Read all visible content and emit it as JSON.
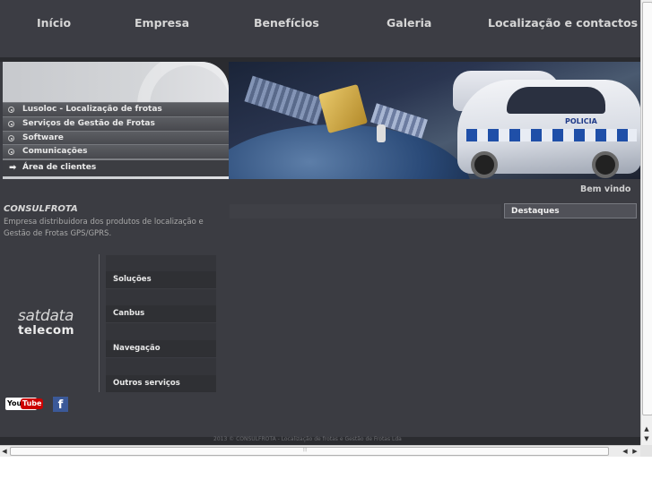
{
  "nav": {
    "items": [
      "Início",
      "Empresa",
      "Benefícios",
      "Galeria",
      "Localização e contactos"
    ]
  },
  "banner_menu": {
    "items": [
      "Lusoloc - Localização de frotas",
      "Serviços de Gestão de Frotas",
      "Software",
      "Comunicações"
    ],
    "client_area": "Área de clientes"
  },
  "welcome": "Bem vindo",
  "company": {
    "name": "CONSULFROTA",
    "description": "Empresa distribuidora dos produtos de localização e Gestão de Frotas GPS/GPRS."
  },
  "highlights": {
    "title": "Destaques"
  },
  "logo": {
    "line1": "satdata",
    "line2": "telecom"
  },
  "services": {
    "items": [
      "Soluções",
      "Canbus",
      "Navegação",
      "Outros serviços"
    ]
  },
  "social": {
    "youtube_you": "You",
    "youtube_tube": "Tube",
    "facebook": "f"
  },
  "banner_photo": {
    "car_text": "POLICIA"
  },
  "footer": {
    "text": "2013 © CONSULFROTA - Localização de frotas e Gestão de Frotas Lda"
  },
  "colors": {
    "background": "#3b3c42",
    "nav_text": "#d6d6d6",
    "facebook": "#3b5998",
    "youtube": "#cc0000"
  }
}
